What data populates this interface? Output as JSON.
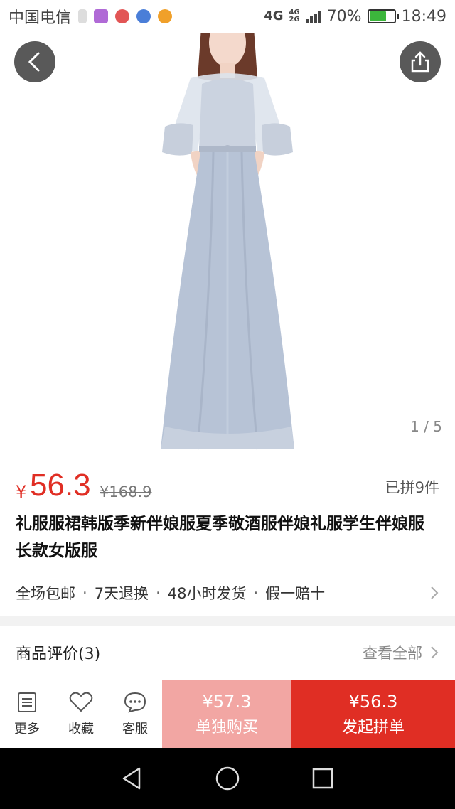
{
  "status_bar": {
    "carrier": "中国电信",
    "network": "4G",
    "network_small_top": "4G",
    "network_small_bottom": "2G",
    "battery": "70%",
    "battery_level": 0.7,
    "time": "18:49"
  },
  "hero": {
    "pager": "1 / 5"
  },
  "product": {
    "currency": "¥",
    "price": "56.3",
    "original_price": "¥168.9",
    "sold": "已拼9件",
    "title": "礼服服裙韩版季新伴娘服夏季敬酒服伴娘礼服学生伴娘服长款女版服"
  },
  "services": {
    "items": [
      "全场包邮",
      "7天退换",
      "48小时发货",
      "假一赔十"
    ],
    "separator": "·"
  },
  "reviews": {
    "title": "商品评价(3)",
    "view_all": "查看全部"
  },
  "action_bar": {
    "more_label": "更多",
    "favorite_label": "收藏",
    "service_label": "客服",
    "buy_alone_price": "¥57.3",
    "buy_alone_label": "单独购买",
    "buy_group_price": "¥56.3",
    "buy_group_label": "发起拼单"
  },
  "colors": {
    "accent_red": "#e02e24",
    "light_red": "#f2a6a3",
    "dress_blue": "#b7c3d6"
  },
  "icons": [
    "back-icon",
    "share-icon",
    "more-icon",
    "heart-icon",
    "chat-icon",
    "chevron-right-icon",
    "nav-back-icon",
    "nav-home-icon",
    "nav-recents-icon"
  ]
}
